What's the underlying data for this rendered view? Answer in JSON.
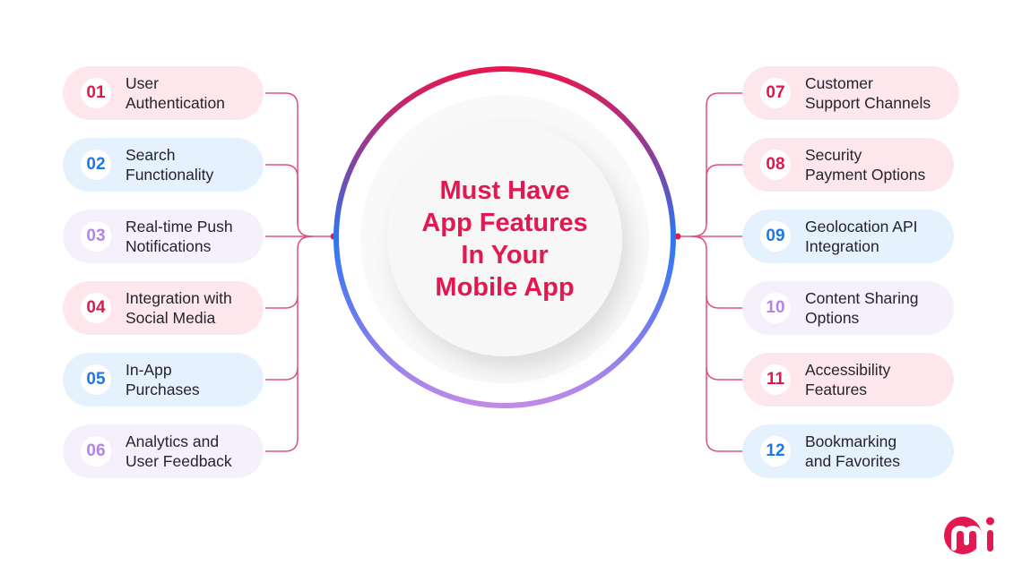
{
  "title": {
    "lines": [
      "Must Have",
      "App Features",
      "In Your",
      "Mobile App"
    ]
  },
  "colors": {
    "accent": "#e3184f",
    "blue": "#1e78e4",
    "lavender": "#b483e6",
    "connector": "#e0507a"
  },
  "features_left": [
    {
      "num": "01",
      "line1": "User",
      "line2": "Authentication",
      "theme": "pink"
    },
    {
      "num": "02",
      "line1": "Search",
      "line2": "Functionality",
      "theme": "blue"
    },
    {
      "num": "03",
      "line1": "Real-time Push",
      "line2": "Notifications",
      "theme": "lav"
    },
    {
      "num": "04",
      "line1": "Integration with",
      "line2": "Social Media",
      "theme": "pink"
    },
    {
      "num": "05",
      "line1": "In-App",
      "line2": "Purchases",
      "theme": "blue"
    },
    {
      "num": "06",
      "line1": "Analytics and",
      "line2": "User Feedback",
      "theme": "lav"
    }
  ],
  "features_right": [
    {
      "num": "07",
      "line1": "Customer",
      "line2": "Support Channels",
      "theme": "pink"
    },
    {
      "num": "08",
      "line1": "Security",
      "line2": "Payment Options",
      "theme": "pink"
    },
    {
      "num": "09",
      "line1": "Geolocation API",
      "line2": "Integration",
      "theme": "blue"
    },
    {
      "num": "10",
      "line1": "Content Sharing",
      "line2": "Options",
      "theme": "lav"
    },
    {
      "num": "11",
      "line1": "Accessibility",
      "line2": "Features",
      "theme": "pink"
    },
    {
      "num": "12",
      "line1": "Bookmarking",
      "line2": "and Favorites",
      "theme": "blue"
    }
  ],
  "logo": {
    "icon": "mi-brand-logo"
  }
}
